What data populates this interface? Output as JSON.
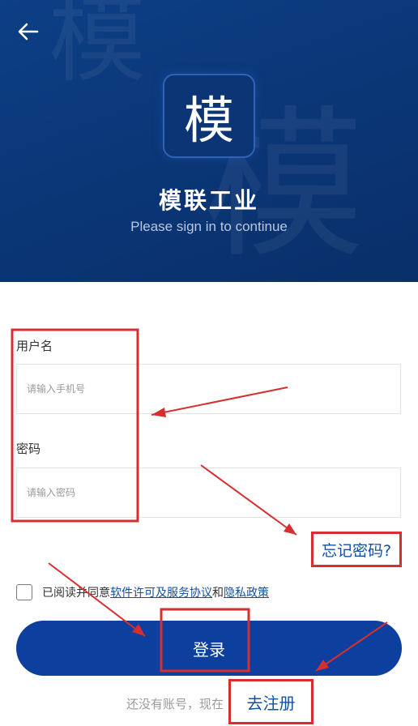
{
  "header": {
    "watermark_glyph": "模",
    "app_name": "模联工业",
    "subtitle": "Please sign in to continue",
    "logo_glyph": "模"
  },
  "form": {
    "username": {
      "label": "用户名",
      "placeholder": "请输入手机号",
      "value": ""
    },
    "password": {
      "label": "密码",
      "placeholder": "请输入密码",
      "value": ""
    },
    "forgot_password": "忘记密码?",
    "agreement": {
      "prefix": "已阅读并同意",
      "license_link": "软件许可及服务协议",
      "conjunction": "和",
      "privacy_link": "隐私政策",
      "checked": false
    },
    "login_button": "登录",
    "register_prompt": "还没有账号，现在",
    "register_link": "去注册"
  },
  "icons": {
    "back": "arrow-left-icon"
  },
  "colors": {
    "header_bg": "#0b3778",
    "primary_button": "#0d3f9f",
    "link": "#1450a0",
    "annotation_red": "#d62f2f"
  }
}
